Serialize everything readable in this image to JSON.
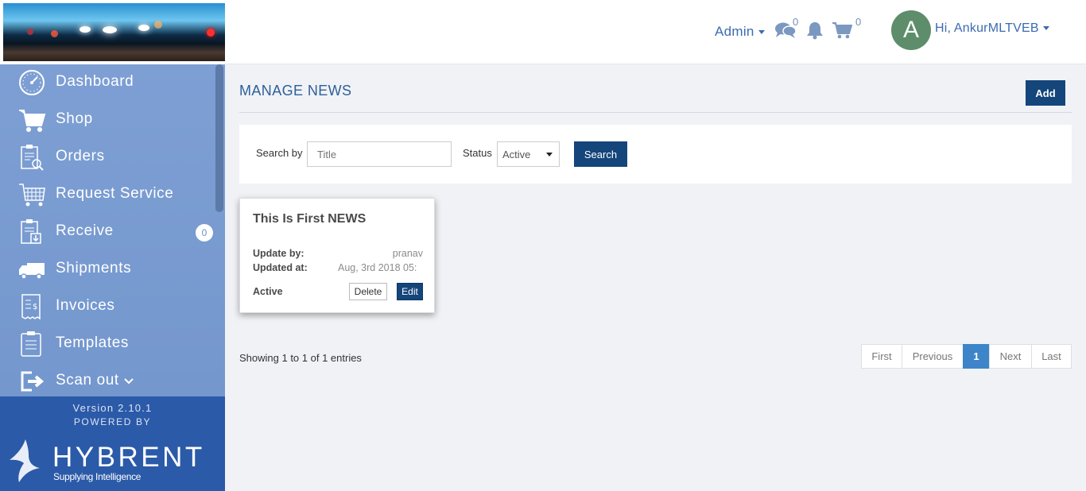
{
  "sidebar": {
    "items": [
      {
        "label": "Dashboard",
        "icon": "dashboard-icon"
      },
      {
        "label": "Shop",
        "icon": "cart-icon"
      },
      {
        "label": "Orders",
        "icon": "orders-icon"
      },
      {
        "label": "Request Service",
        "icon": "request-service-icon"
      },
      {
        "label": "Receive",
        "icon": "receive-icon",
        "badge": "0"
      },
      {
        "label": "Shipments",
        "icon": "truck-icon"
      },
      {
        "label": "Invoices",
        "icon": "invoice-icon"
      },
      {
        "label": "Templates",
        "icon": "templates-icon"
      },
      {
        "label": "Scan out",
        "icon": "scan-out-icon"
      }
    ],
    "version": "Version 2.10.1",
    "powered_by": "POWERED BY",
    "brand": "HYBRENT",
    "tagline": "Supplying Intelligence"
  },
  "header": {
    "admin_label": "Admin",
    "messages_count": "0",
    "cart_count": "0",
    "avatar_letter": "A",
    "greeting": "Hi, AnkurMLTVEB"
  },
  "main": {
    "title": "MANAGE NEWS",
    "add_label": "Add",
    "filter": {
      "search_by_label": "Search by",
      "search_placeholder": "Title",
      "status_label": "Status",
      "status_value": "Active",
      "search_button": "Search"
    },
    "news": [
      {
        "title": "This Is First NEWS",
        "update_by_label": "Update by:",
        "update_by": "pranav",
        "updated_at_label": "Updated at:",
        "updated_at": "Aug, 3rd 2018 05:",
        "status": "Active",
        "delete_label": "Delete",
        "edit_label": "Edit"
      }
    ],
    "showing": "Showing 1 to 1 of 1 entries",
    "pagination": {
      "first": "First",
      "previous": "Previous",
      "current": "1",
      "next": "Next",
      "last": "Last"
    }
  },
  "colors": {
    "sidebar": "#7a9ed3",
    "footer": "#2b5aa8",
    "primary_button": "#14457b",
    "link": "#3c6bb0",
    "active_page": "#3d85c8"
  }
}
